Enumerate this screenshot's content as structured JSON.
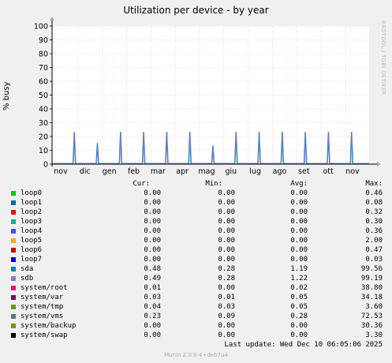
{
  "chart_data": {
    "type": "line",
    "title": "Utilization per device - by year",
    "ylabel": "% busy",
    "ylim": [
      0,
      100
    ],
    "yticks": [
      0,
      10,
      20,
      30,
      40,
      50,
      60,
      70,
      80,
      90,
      100
    ],
    "x_labels": [
      "nov",
      "dic",
      "gen",
      "feb",
      "mar",
      "apr",
      "mag",
      "giu",
      "lug",
      "ago",
      "set",
      "ott",
      "nov"
    ],
    "grid": true,
    "series": [
      {
        "name": "sda",
        "color": "#0080c0",
        "spikes": [
          23,
          15,
          23,
          23,
          23,
          23,
          13,
          23,
          23,
          23,
          23,
          23,
          23
        ]
      },
      {
        "name": "sdb",
        "color": "#8080c0",
        "spikes": [
          23,
          15,
          23,
          23,
          23,
          23,
          13,
          23,
          23,
          23,
          23,
          23,
          23
        ]
      }
    ]
  },
  "watermark": "RRDTOOL / TOBI OETIKER",
  "legend": {
    "headers": {
      "cur": "Cur:",
      "min": "Min:",
      "avg": "Avg:",
      "max": "Max:"
    },
    "rows": [
      {
        "name": "loop0",
        "color": "#00cc00",
        "cur": "0.00",
        "min": "0.00",
        "avg": "0.00",
        "max": "0.46"
      },
      {
        "name": "loop1",
        "color": "#0066b3",
        "cur": "0.00",
        "min": "0.00",
        "avg": "0.00",
        "max": "0.08"
      },
      {
        "name": "loop2",
        "color": "#ff0000",
        "cur": "0.00",
        "min": "0.00",
        "avg": "0.00",
        "max": "0.32"
      },
      {
        "name": "loop3",
        "color": "#00b3a0",
        "cur": "0.00",
        "min": "0.00",
        "avg": "0.00",
        "max": "0.30"
      },
      {
        "name": "loop4",
        "color": "#3355ff",
        "cur": "0.00",
        "min": "0.00",
        "avg": "0.00",
        "max": "0.36"
      },
      {
        "name": "loop5",
        "color": "#ffaa00",
        "cur": "0.00",
        "min": "0.00",
        "avg": "0.00",
        "max": "2.00"
      },
      {
        "name": "loop6",
        "color": "#cc0000",
        "cur": "0.00",
        "min": "0.00",
        "avg": "0.00",
        "max": "0.47"
      },
      {
        "name": "loop7",
        "color": "#0000cc",
        "cur": "0.00",
        "min": "0.00",
        "avg": "0.00",
        "max": "0.03"
      },
      {
        "name": "sda",
        "color": "#0080c0",
        "cur": "0.48",
        "min": "0.28",
        "avg": "1.19",
        "max": "99.56"
      },
      {
        "name": "sdb",
        "color": "#8080c0",
        "cur": "0.49",
        "min": "0.28",
        "avg": "1.22",
        "max": "99.19"
      },
      {
        "name": "system/root",
        "color": "#ff0080",
        "cur": "0.01",
        "min": "0.00",
        "avg": "0.02",
        "max": "38.80"
      },
      {
        "name": "system/var",
        "color": "#800080",
        "cur": "0.03",
        "min": "0.01",
        "avg": "0.05",
        "max": "34.18"
      },
      {
        "name": "system/tmp",
        "color": "#669900",
        "cur": "0.04",
        "min": "0.03",
        "avg": "0.05",
        "max": "3.60"
      },
      {
        "name": "system/vms",
        "color": "#4d8080",
        "cur": "0.23",
        "min": "0.09",
        "avg": "0.28",
        "max": "72.53"
      },
      {
        "name": "system/backup",
        "color": "#8c8c00",
        "cur": "0.00",
        "min": "0.00",
        "avg": "0.00",
        "max": "30.36"
      },
      {
        "name": "system/swap",
        "color": "#000000",
        "cur": "0.00",
        "min": "0.00",
        "avg": "0.00",
        "max": "3.30"
      }
    ]
  },
  "last_update": "Last update: Wed Dec 10 06:05:06 2025",
  "footer": "Munin 2.0.6-4+deb7u4"
}
